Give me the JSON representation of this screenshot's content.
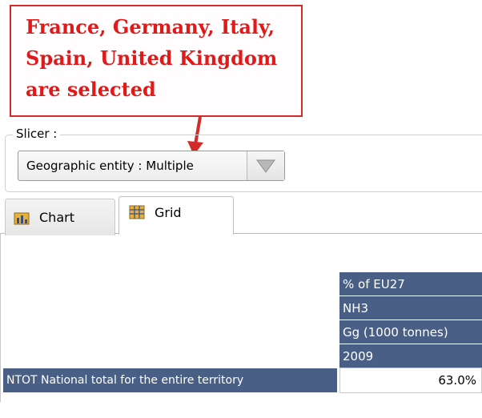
{
  "annotation": {
    "lines": [
      "France, Germany, Italy,",
      "Spain, United Kingdom",
      "are selected"
    ],
    "color": "#e01a1a"
  },
  "slicer": {
    "label": "Slicer :",
    "selected_value": "Geographic entity : Multiple",
    "dropdown_icon": "triangle-down-icon"
  },
  "tabs": [
    {
      "label": "Chart",
      "icon": "chart-icon",
      "active": false
    },
    {
      "label": "Grid",
      "icon": "grid-icon",
      "active": true
    }
  ],
  "grid": {
    "column_headers": [
      "% of EU27",
      "NH3",
      "Gg (1000 tonnes)",
      "2009"
    ],
    "rows": [
      {
        "label": "NTOT National total for the entire territory",
        "value": "63.0%"
      }
    ],
    "header_color": "#4a5f86"
  }
}
